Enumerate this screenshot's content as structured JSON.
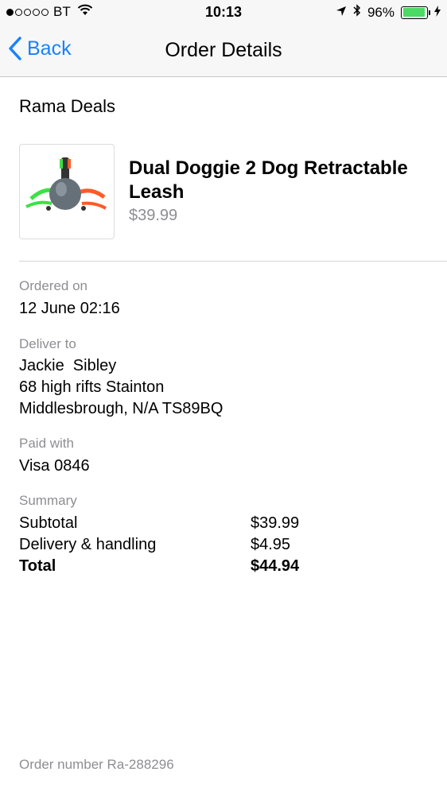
{
  "status_bar": {
    "carrier": "BT",
    "time": "10:13",
    "battery": "96%",
    "battery_level": 0.96
  },
  "nav": {
    "back_label": "Back",
    "title": "Order Details"
  },
  "order": {
    "store": "Rama Deals",
    "product": {
      "name": "Dual Doggie 2 Dog Retractable Leash",
      "price": "$39.99"
    },
    "ordered_on_label": "Ordered on",
    "ordered_on": "12 June 02:16",
    "deliver_to_label": "Deliver to",
    "deliver_to": {
      "name": "Jackie  Sibley",
      "line1": "68 high rifts Stainton",
      "line2": "Middlesbrough, N/A TS89BQ"
    },
    "paid_with_label": "Paid with",
    "paid_with": "Visa 0846",
    "summary_label": "Summary",
    "summary": [
      {
        "label": "Subtotal",
        "amount": "$39.99"
      },
      {
        "label": "Delivery & handling",
        "amount": "$4.95"
      },
      {
        "label": "Total",
        "amount": "$44.94"
      }
    ],
    "order_number": "Order number Ra-288296"
  },
  "colors": {
    "accent": "#1a82fb",
    "secondary_text": "#8e8e93",
    "battery": "#4cd964"
  }
}
